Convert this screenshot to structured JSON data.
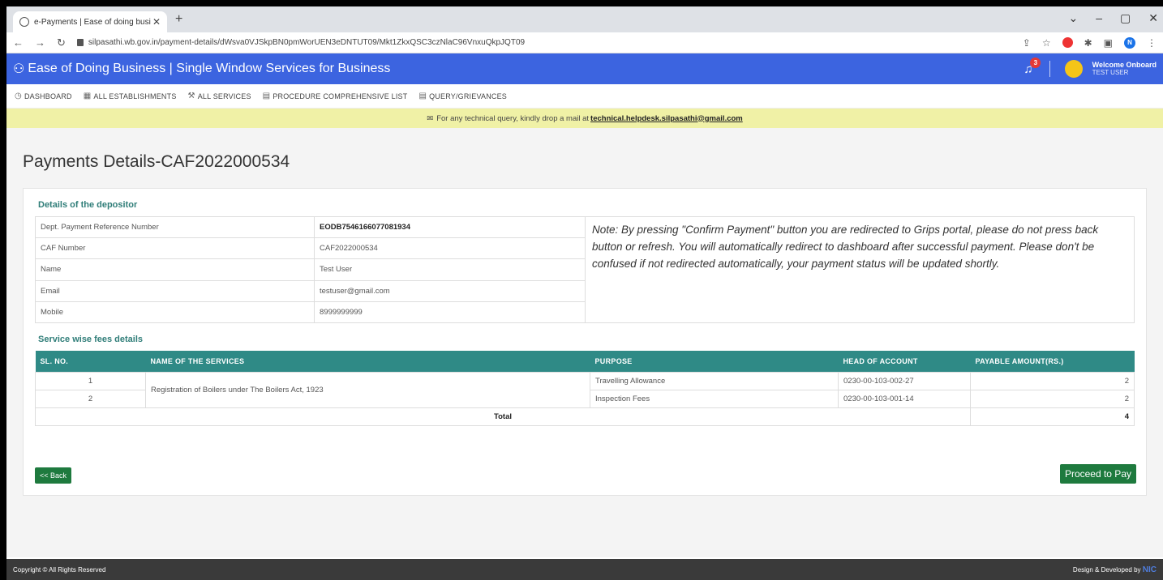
{
  "browser": {
    "tab_title": "e-Payments | Ease of doing busi",
    "url": "silpasathi.wb.gov.in/payment-details/dWsva0VJSkpBN0pmWorUEN3eDNTUT09/Mkt1ZkxQSC3czNlaC96VnxuQkpJQT09",
    "profile_initial": "N"
  },
  "header": {
    "brand": "Ease of Doing Business | Single Window Services for Business",
    "notif_count": "3",
    "welcome": "Welcome Onboard",
    "user": "TEST USER"
  },
  "menu": [
    "DASHBOARD",
    "ALL ESTABLISHMENTS",
    "ALL SERVICES",
    "PROCEDURE COMPREHENSIVE LIST",
    "QUERY/GRIEVANCES"
  ],
  "notice": {
    "text": "For any technical query, kindly drop a mail at",
    "email": "technical.helpdesk.silpasathi@gmail.com"
  },
  "page_title": "Payments Details-CAF2022000534",
  "depositor": {
    "heading": "Details of the depositor",
    "rows": [
      {
        "label": "Dept. Payment Reference Number",
        "value": "EODB7546166077081934"
      },
      {
        "label": "CAF Number",
        "value": "CAF2022000534"
      },
      {
        "label": "Name",
        "value": "Test User"
      },
      {
        "label": "Email",
        "value": "testuser@gmail.com"
      },
      {
        "label": "Mobile",
        "value": "8999999999"
      }
    ],
    "note": "Note: By pressing \"Confirm Payment\" button you are redirected to Grips portal, please do not press back button or refresh. You will automatically redirect to dashboard after successful payment. Please don't be confused if not redirected automatically, your payment status will be updated shortly."
  },
  "fees": {
    "heading": "Service wise fees details",
    "columns": [
      "SL. NO.",
      "NAME OF THE SERVICES",
      "PURPOSE",
      "HEAD OF ACCOUNT",
      "PAYABLE AMOUNT(RS.)"
    ],
    "service_name": "Registration of Boilers under The Boilers Act, 1923",
    "rows": [
      {
        "sl": "1",
        "purpose": "Travelling Allowance",
        "head": "0230-00-103-002-27",
        "amount": "2"
      },
      {
        "sl": "2",
        "purpose": "Inspection Fees",
        "head": "0230-00-103-001-14",
        "amount": "2"
      }
    ],
    "total_label": "Total",
    "total": "4"
  },
  "buttons": {
    "back": "<< Back",
    "pay": "Proceed to Pay"
  },
  "footer": {
    "left": "Copyright © All Rights Reserved",
    "right": "Design & Developed by",
    "logo": "NIC"
  }
}
